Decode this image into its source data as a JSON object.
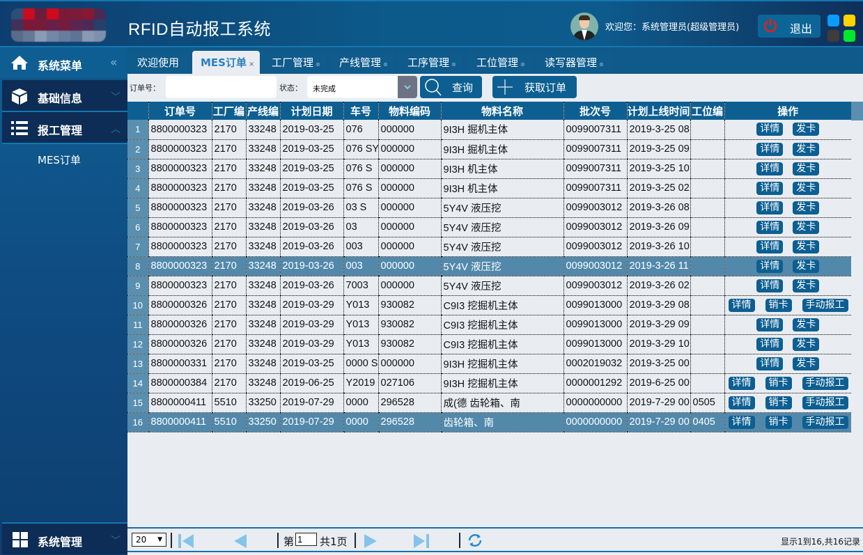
{
  "header": {
    "app_title": "RFID自动报工系统",
    "welcome_text": "欢迎您：系统管理员(超级管理员)",
    "logout_label": "退出",
    "skin_colors": [
      "#0a9bff",
      "#ffd400",
      "#403c3c",
      "#00e82c"
    ]
  },
  "sidebar": {
    "header_label": "系统菜单",
    "collapse_icon": "«",
    "items": [
      {
        "label": "基础信息",
        "icon": "cube-icon",
        "expanded": false
      },
      {
        "label": "报工管理",
        "icon": "list-icon",
        "expanded": true,
        "children": [
          {
            "label": "MES订单"
          }
        ]
      },
      {
        "label": "系统管理",
        "icon": "windows-icon",
        "expanded": false
      }
    ]
  },
  "tabs": [
    {
      "label": "欢迎使用",
      "active": false,
      "closable": false
    },
    {
      "label": "MES订单",
      "active": true,
      "closable": true
    },
    {
      "label": "工厂管理",
      "active": false,
      "closable": true
    },
    {
      "label": "产线管理",
      "active": false,
      "closable": true
    },
    {
      "label": "工序管理",
      "active": false,
      "closable": true
    },
    {
      "label": "工位管理",
      "active": false,
      "closable": true
    },
    {
      "label": "读写器管理",
      "active": false,
      "closable": true
    }
  ],
  "search": {
    "order_label": "订单号：",
    "order_value": "",
    "status_label": "状态：",
    "status_value": "未完成",
    "query_label": "查询",
    "fetch_label": "获取订单"
  },
  "table": {
    "columns": [
      "",
      "订单号",
      "工厂编",
      "产线编",
      "计划日期",
      "车号",
      "物料编码",
      "物料名称",
      "批次号",
      "计划上线时间",
      "工位编",
      "操作"
    ],
    "selected_rows": [
      8,
      16
    ],
    "rows": [
      {
        "n": "1",
        "order": "8800000323",
        "factory": "2170",
        "line": "33248",
        "date": "2019-03-25",
        "car": "076",
        "mcode": "000000",
        "mname": "9I3H 掘机主体",
        "batch": "0099007311",
        "online": "2019-3-25 08",
        "station": "",
        "ops": [
          "详情",
          "发卡"
        ]
      },
      {
        "n": "2",
        "order": "8800000323",
        "factory": "2170",
        "line": "33248",
        "date": "2019-03-25",
        "car": "076 SY",
        "mcode": "000000",
        "mname": "9I3H 掘机主体",
        "batch": "0099007311",
        "online": "2019-3-25 09",
        "station": "",
        "ops": [
          "详情",
          "发卡"
        ]
      },
      {
        "n": "3",
        "order": "8800000323",
        "factory": "2170",
        "line": "33248",
        "date": "2019-03-25",
        "car": "076 S",
        "mcode": "000000",
        "mname": "9I3H 机主体",
        "batch": "0099007311",
        "online": "2019-3-25 10",
        "station": "",
        "ops": [
          "详情",
          "发卡"
        ]
      },
      {
        "n": "4",
        "order": "8800000323",
        "factory": "2170",
        "line": "33248",
        "date": "2019-03-25",
        "car": "076 S",
        "mcode": "000000",
        "mname": "9I3H 机主体",
        "batch": "0099007311",
        "online": "2019-3-25 02",
        "station": "",
        "ops": [
          "详情",
          "发卡"
        ]
      },
      {
        "n": "5",
        "order": "8800000323",
        "factory": "2170",
        "line": "33248",
        "date": "2019-03-26",
        "car": "03 S",
        "mcode": "000000",
        "mname": "5Y4V 液压挖",
        "batch": "0099003012",
        "online": "2019-3-26 08",
        "station": "",
        "ops": [
          "详情",
          "发卡"
        ]
      },
      {
        "n": "6",
        "order": "8800000323",
        "factory": "2170",
        "line": "33248",
        "date": "2019-03-26",
        "car": "03",
        "mcode": "000000",
        "mname": "5Y4V 液压挖",
        "batch": "0099003012",
        "online": "2019-3-26 09",
        "station": "",
        "ops": [
          "详情",
          "发卡"
        ]
      },
      {
        "n": "7",
        "order": "8800000323",
        "factory": "2170",
        "line": "33248",
        "date": "2019-03-26",
        "car": "003",
        "mcode": "000000",
        "mname": "5Y4V 液压挖",
        "batch": "0099003012",
        "online": "2019-3-26 10",
        "station": "",
        "ops": [
          "详情",
          "发卡"
        ]
      },
      {
        "n": "8",
        "order": "8800000323",
        "factory": "2170",
        "line": "33248",
        "date": "2019-03-26",
        "car": "003",
        "mcode": "000000",
        "mname": "5Y4V 液压挖",
        "batch": "0099003012",
        "online": "2019-3-26 11",
        "station": "",
        "ops": [
          "详情",
          "发卡"
        ]
      },
      {
        "n": "9",
        "order": "8800000323",
        "factory": "2170",
        "line": "33248",
        "date": "2019-03-26",
        "car": "7003",
        "mcode": "000000",
        "mname": "5Y4V 液压挖",
        "batch": "0099003012",
        "online": "2019-3-26 02",
        "station": "",
        "ops": [
          "详情",
          "发卡"
        ]
      },
      {
        "n": "10",
        "order": "8800000326",
        "factory": "2170",
        "line": "33248",
        "date": "2019-03-29",
        "car": "Y013",
        "mcode": "930082",
        "mname": "C9I3 挖掘机主体",
        "batch": "0099013000",
        "online": "2019-3-29 08",
        "station": "",
        "ops": [
          "详情",
          "销卡",
          "手动报工"
        ]
      },
      {
        "n": "11",
        "order": "8800000326",
        "factory": "2170",
        "line": "33248",
        "date": "2019-03-29",
        "car": "Y013",
        "mcode": "930082",
        "mname": "C9I3 挖掘机主体",
        "batch": "0099013000",
        "online": "2019-3-29 09",
        "station": "",
        "ops": [
          "详情",
          "发卡"
        ]
      },
      {
        "n": "12",
        "order": "8800000326",
        "factory": "2170",
        "line": "33248",
        "date": "2019-03-29",
        "car": "Y013",
        "mcode": "930082",
        "mname": "C9I3 挖掘机主体",
        "batch": "0099013000",
        "online": "2019-3-29 10",
        "station": "",
        "ops": [
          "详情",
          "发卡"
        ]
      },
      {
        "n": "13",
        "order": "8800000331",
        "factory": "2170",
        "line": "33248",
        "date": "2019-03-25",
        "car": "0000 S",
        "mcode": "000000",
        "mname": "9I3H 挖掘机主体",
        "batch": "0002019032",
        "online": "2019-3-25 00",
        "station": "",
        "ops": [
          "详情",
          "发卡"
        ]
      },
      {
        "n": "14",
        "order": "8800000384",
        "factory": "2170",
        "line": "33248",
        "date": "2019-06-25",
        "car": "Y2019",
        "mcode": "027106",
        "mname": "9I3H 挖掘机主体",
        "batch": "0000001292",
        "online": "2019-6-25 00",
        "station": "",
        "ops": [
          "详情",
          "销卡",
          "手动报工"
        ]
      },
      {
        "n": "15",
        "order": "8800000411",
        "factory": "5510",
        "line": "33250",
        "date": "2019-07-29",
        "car": "0000",
        "mcode": "296528",
        "mname": "成(德 齿轮箱、南",
        "batch": "0000000000",
        "online": "2019-7-29 00",
        "station": "0505",
        "ops": [
          "详情",
          "销卡",
          "手动报工"
        ]
      },
      {
        "n": "16",
        "order": "8800000411",
        "factory": "5510",
        "line": "33250",
        "date": "2019-07-29",
        "car": "0000",
        "mcode": "296528",
        "mname": "齿轮箱、南",
        "batch": "0000000000",
        "online": "2019-7-29 00",
        "station": "0405",
        "ops": [
          "详情",
          "销卡",
          "手动报工"
        ]
      }
    ]
  },
  "pager": {
    "page_size": "20",
    "page_prefix": "第",
    "current_page": "1",
    "page_suffix": "共1页",
    "records_text": "显示1到16,共16记录"
  }
}
